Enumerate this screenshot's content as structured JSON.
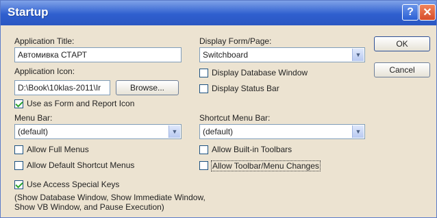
{
  "window": {
    "title": "Startup"
  },
  "left": {
    "app_title_label": "Application Title:",
    "app_title_value": "Автомивка СТАРТ",
    "app_icon_label": "Application Icon:",
    "app_icon_value": "D:\\Book\\10klas-2011\\Ir",
    "browse_label": "Browse...",
    "use_as_icon_label": "Use as Form and Report Icon",
    "menu_bar_label": "Menu Bar:",
    "menu_bar_value": "(default)",
    "allow_full_menus_label": "Allow Full Menus",
    "allow_default_shortcut_label": "Allow Default Shortcut Menus",
    "use_special_keys_label": "Use Access Special Keys",
    "special_keys_note": "(Show Database Window, Show Immediate Window, Show VB Window, and Pause Execution)"
  },
  "right": {
    "display_form_label": "Display Form/Page:",
    "display_form_value": "Switchboard",
    "display_db_window_label": "Display Database Window",
    "display_status_bar_label": "Display Status Bar",
    "shortcut_menu_bar_label": "Shortcut Menu Bar:",
    "shortcut_menu_bar_value": "(default)",
    "allow_builtin_toolbars_label": "Allow Built-in Toolbars",
    "allow_toolbar_changes_label": "Allow Toolbar/Menu Changes"
  },
  "buttons": {
    "ok": "OK",
    "cancel": "Cancel"
  },
  "checks": {
    "use_as_icon": true,
    "allow_full_menus": false,
    "allow_default_shortcut": false,
    "use_special_keys": true,
    "display_db_window": false,
    "display_status_bar": false,
    "allow_builtin_toolbars": false,
    "allow_toolbar_changes": false
  }
}
